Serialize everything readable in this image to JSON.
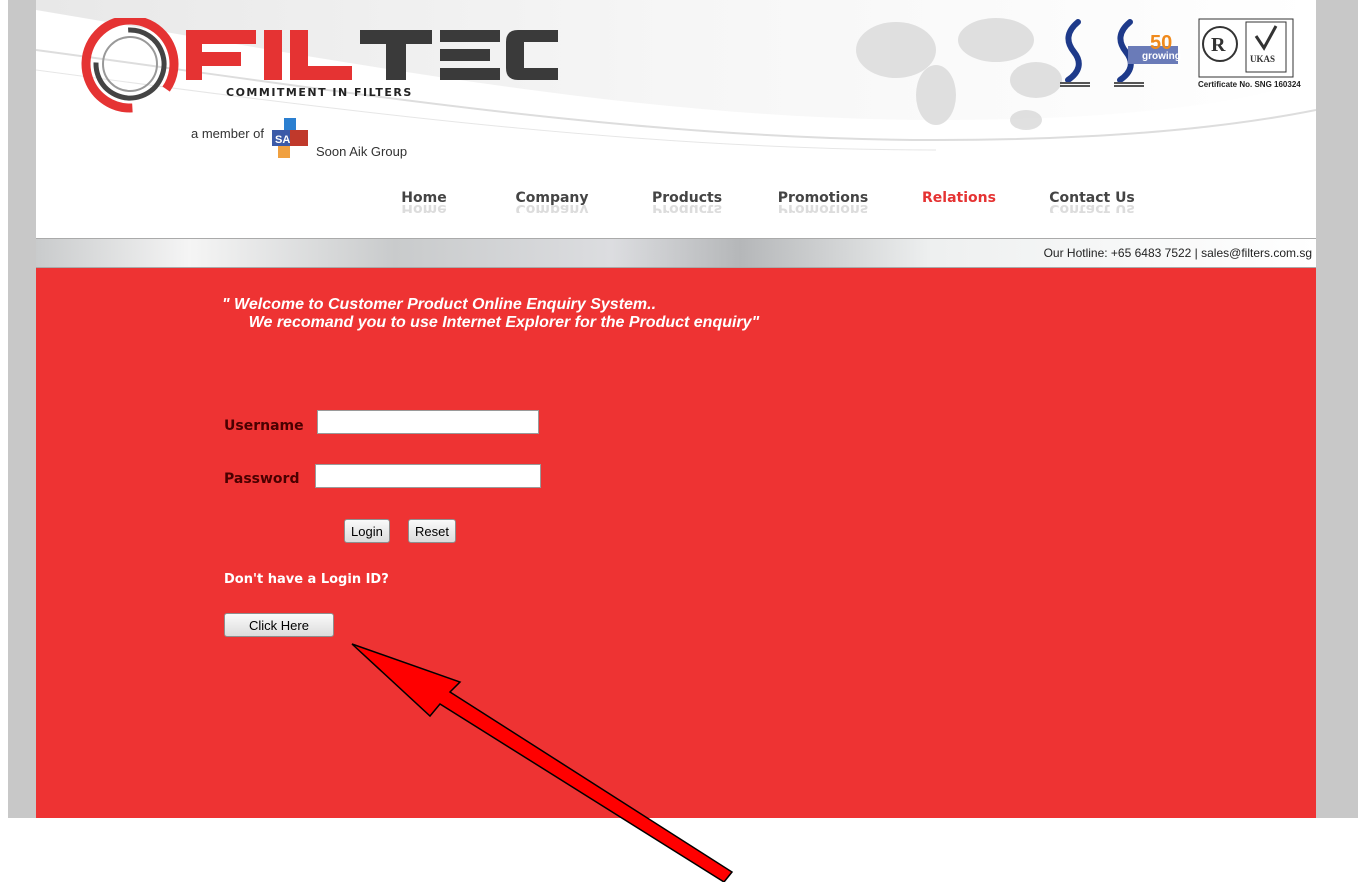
{
  "brand": {
    "name": "FILTEC",
    "tagline": "COMMITMENT IN FILTERS",
    "member_prefix": "a member of",
    "group_logo": "SA",
    "group_name": "Soon Aik Group",
    "accent": "#ee3333"
  },
  "certification": {
    "badge_50": "50",
    "badge_growing": "growing",
    "certificate_text": "Certificate No. SNG 160324"
  },
  "nav": {
    "items": [
      {
        "label": "Home"
      },
      {
        "label": "Company"
      },
      {
        "label": "Products"
      },
      {
        "label": "Promotions"
      },
      {
        "label": "Relations"
      },
      {
        "label": "Contact Us"
      }
    ],
    "active": "Relations"
  },
  "hotline": "Our Hotline: +65 6483 7522 | sales@filters.com.sg",
  "welcome": {
    "line1": "\" Welcome to Customer Product Online Enquiry System..",
    "line2": "      We recomand you to use Internet Explorer for the Product enquiry\""
  },
  "form": {
    "username_label": "Username",
    "username_value": "",
    "password_label": "Password",
    "password_value": "",
    "login_button": "Login",
    "reset_button": "Reset",
    "no_id_text": "Don't have a Login ID?",
    "click_here_button": "Click Here"
  },
  "annotation": {
    "arrow_color": "#ff0000"
  }
}
